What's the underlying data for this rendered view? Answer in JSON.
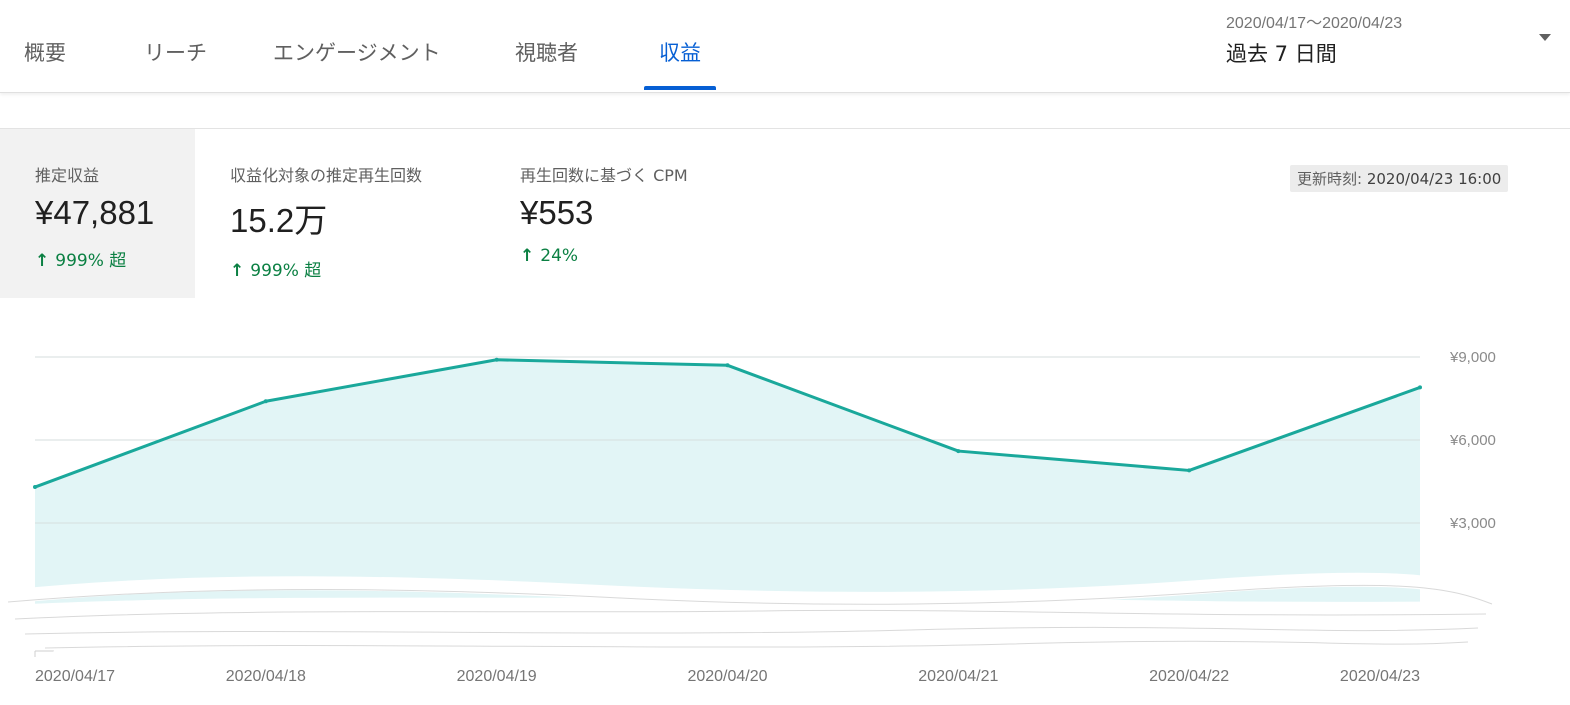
{
  "nav": {
    "tabs": [
      {
        "label": "概要"
      },
      {
        "label": "リーチ"
      },
      {
        "label": "エンゲージメント"
      },
      {
        "label": "視聴者"
      },
      {
        "label": "収益"
      }
    ],
    "active_tab": "収益",
    "date_range": "2020/04/17～2020/04/23",
    "period": "過去 7 日間"
  },
  "metrics": [
    {
      "label": "推定収益",
      "value": "¥47,881",
      "change": "999% 超",
      "arrow": "↑"
    },
    {
      "label": "収益化対象の推定再生回数",
      "value": "15.2万",
      "change": "999% 超",
      "arrow": "↑"
    },
    {
      "label": "再生回数に基づく CPM",
      "value": "¥553",
      "change": "24%",
      "arrow": "↑"
    }
  ],
  "update": {
    "label": "更新時刻:",
    "time": "2020/04/23 16:00"
  },
  "colors": {
    "accent": "#065fd4",
    "positive": "#0b8043",
    "line": "#1aa89b",
    "area": "#e2f5f6"
  },
  "chart_data": {
    "type": "area",
    "x": [
      "2020/04/17",
      "2020/04/18",
      "2020/04/19",
      "2020/04/20",
      "2020/04/21",
      "2020/04/22",
      "2020/04/23"
    ],
    "series": [
      {
        "values": [
          4300,
          7400,
          8900,
          8700,
          5600,
          4900,
          7900
        ]
      }
    ],
    "y_tick_labels": [
      "¥9,000",
      "¥6,000",
      "¥3,000"
    ],
    "y_ticks": [
      9000,
      6000,
      3000
    ],
    "ylim": [
      0,
      9000
    ],
    "grid": true,
    "y_axis_side": "right"
  }
}
